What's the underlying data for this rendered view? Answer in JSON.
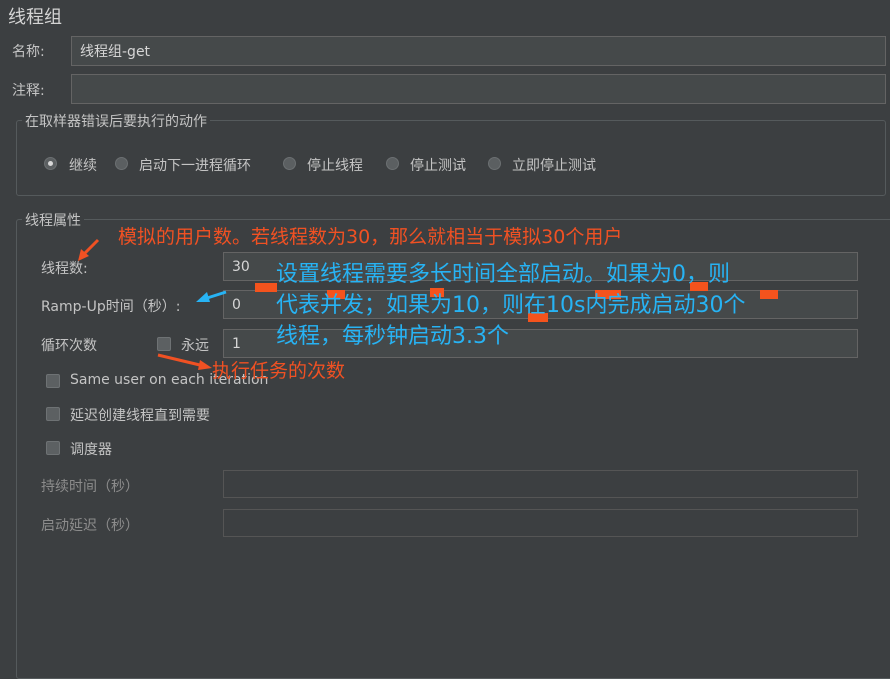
{
  "panel_title": "线程组",
  "name_label": "名称:",
  "name_value": "线程组-get",
  "comment_label": "注释:",
  "comment_value": "",
  "error_group": {
    "title": "在取样器错误后要执行的动作",
    "options": [
      {
        "label": "继续",
        "selected": true
      },
      {
        "label": "启动下一进程循环",
        "selected": false
      },
      {
        "label": "停止线程",
        "selected": false
      },
      {
        "label": "停止测试",
        "selected": false
      },
      {
        "label": "立即停止测试",
        "selected": false
      }
    ]
  },
  "thread_props": {
    "title": "线程属性",
    "num_threads_label": "线程数:",
    "num_threads_value": "30",
    "rampup_label": "Ramp-Up时间（秒）:",
    "rampup_value": "0",
    "loop_label": "循环次数",
    "forever_label": "永远",
    "forever_checked": false,
    "loop_value": "1",
    "same_user_label": "Same user on each iteration",
    "delay_label": "延迟创建线程直到需要",
    "scheduler_label": "调度器",
    "duration_label": "持续时间（秒）",
    "duration_value": "",
    "startup_delay_label": "启动延迟（秒）",
    "startup_delay_value": ""
  },
  "annotations": {
    "users_note": "模拟的用户数。若线程数为30，那么就相当于模拟30个用户",
    "rampup_note_line1": "设置线程需要多长时间全部启动。如果为0，则",
    "rampup_note_line2": "代表并发；如果为10，则在10s内完成启动30个",
    "rampup_note_line3": "线程，每秒钟启动3.3个",
    "loop_note": "执行任务的次数"
  },
  "colors": {
    "background": "#3c3f41",
    "annotation_red": "#f05123",
    "annotation_blue": "#27b3f4"
  }
}
